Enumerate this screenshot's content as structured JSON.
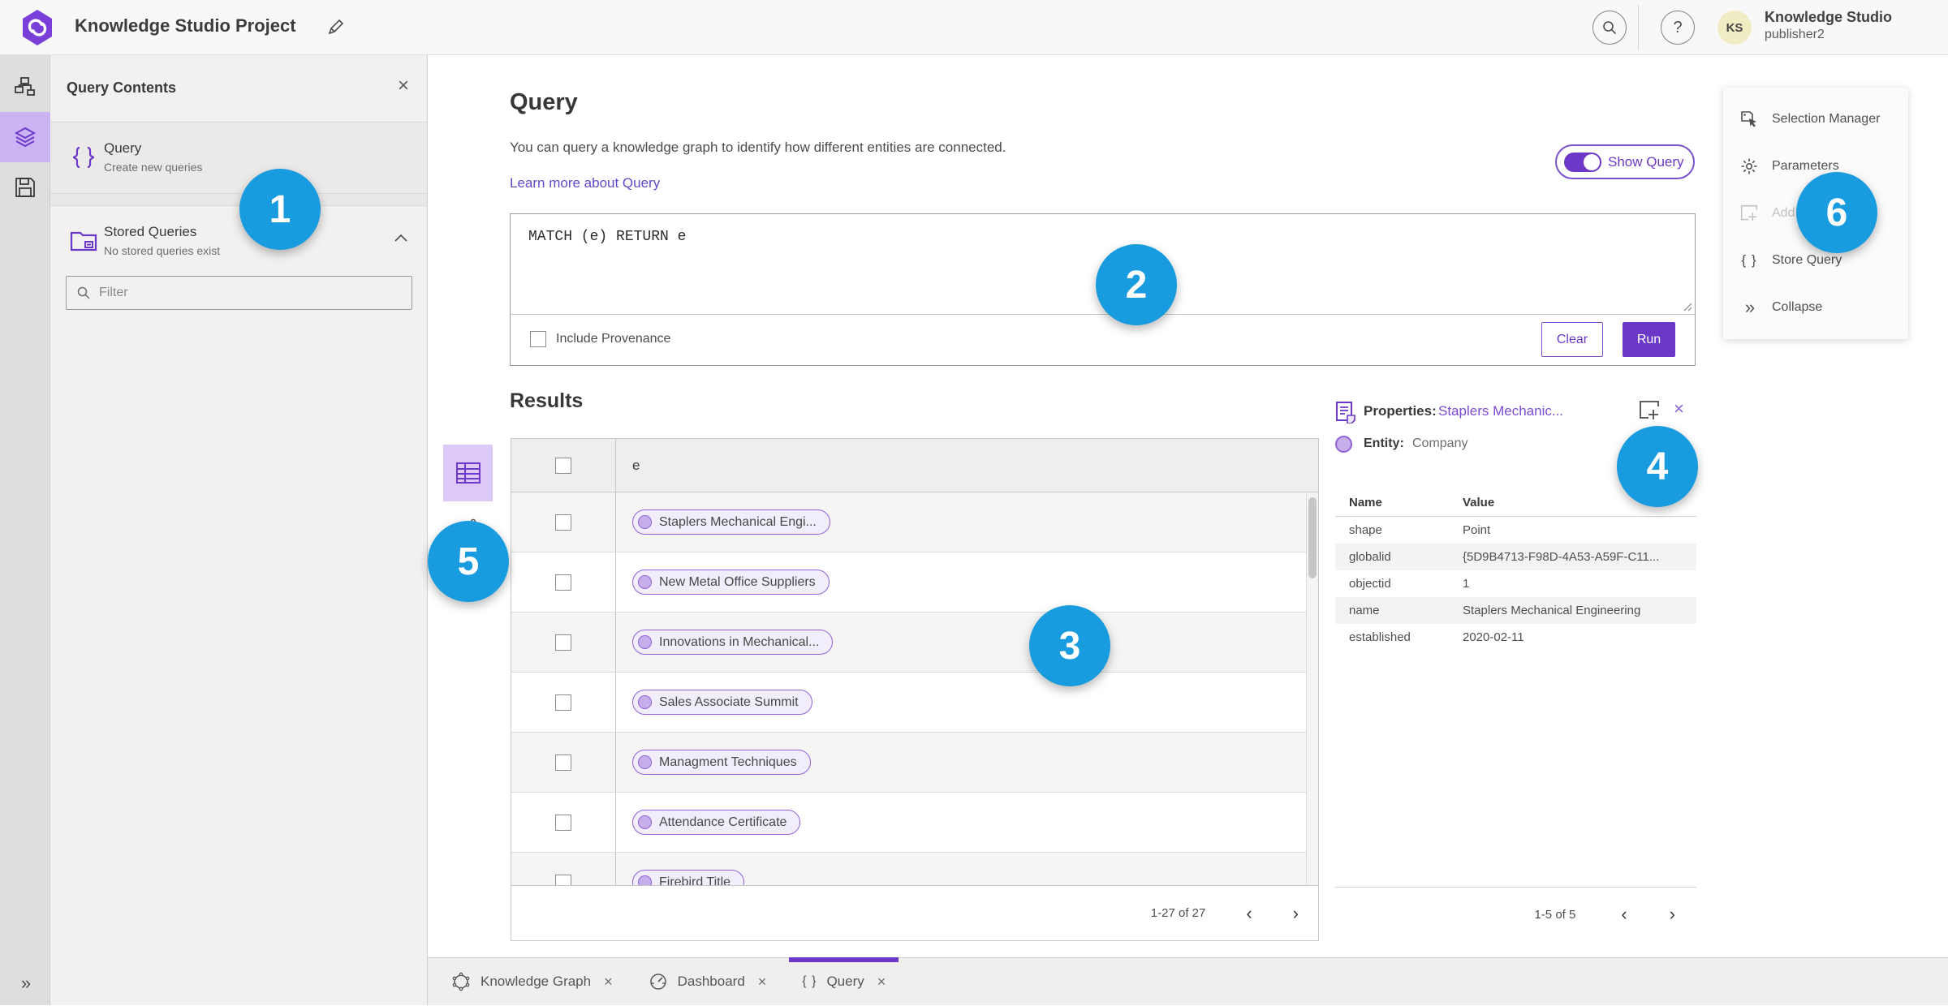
{
  "app": {
    "title": "Knowledge Studio Project",
    "user_org": "Knowledge Studio",
    "user_name": "publisher2",
    "user_initials": "KS"
  },
  "glyphs": {
    "close": "×",
    "help": "?",
    "braces": "{ }",
    "collapse": "»",
    "rail_expand": "»",
    "chevron_left": "‹",
    "chevron_right": "›"
  },
  "colors": {
    "accent_purple": "#6b38c8",
    "badge_blue": "#199bdf"
  },
  "left_panel": {
    "title": "Query Contents",
    "items": [
      {
        "title": "Query",
        "subtitle": "Create new queries"
      },
      {
        "title": "Stored Queries",
        "subtitle": "No stored queries exist"
      }
    ],
    "filter_placeholder": "Filter"
  },
  "query": {
    "title": "Query",
    "description": "You can query a knowledge graph to identify how different entities are connected.",
    "learn_more": "Learn more about Query",
    "show_query": "Show Query",
    "code": "MATCH (e) RETURN e",
    "include_provenance": "Include Provenance",
    "clear": "Clear",
    "run": "Run"
  },
  "results": {
    "title": "Results",
    "column": "e",
    "rows": [
      "Staplers Mechanical Engi...",
      "New Metal Office Suppliers",
      "Innovations in Mechanical...",
      "Sales Associate Summit",
      "Managment Techniques",
      "Attendance Certificate",
      "Firebird Title"
    ],
    "pagination": "1-27 of 27"
  },
  "properties": {
    "label": "Properties:",
    "link": "Staplers Mechanic...",
    "entity_label": "Entity:",
    "entity_value": "Company",
    "col_name": "Name",
    "col_value": "Value",
    "rows": [
      [
        "shape",
        "Point"
      ],
      [
        "globalid",
        "{5D9B4713-F98D-4A53-A59F-C11..."
      ],
      [
        "objectid",
        "1"
      ],
      [
        "name",
        "Staplers Mechanical Engineering"
      ],
      [
        "established",
        "2020-02-11"
      ]
    ],
    "pagination": "1-5 of 5"
  },
  "right_menu": {
    "items": [
      "Selection Manager",
      "Parameters",
      "Add",
      "Store Query",
      "Collapse"
    ]
  },
  "tabs": [
    {
      "label": "Knowledge Graph"
    },
    {
      "label": "Dashboard"
    },
    {
      "label": "Query"
    }
  ],
  "badges": [
    "1",
    "2",
    "3",
    "4",
    "5",
    "6"
  ]
}
